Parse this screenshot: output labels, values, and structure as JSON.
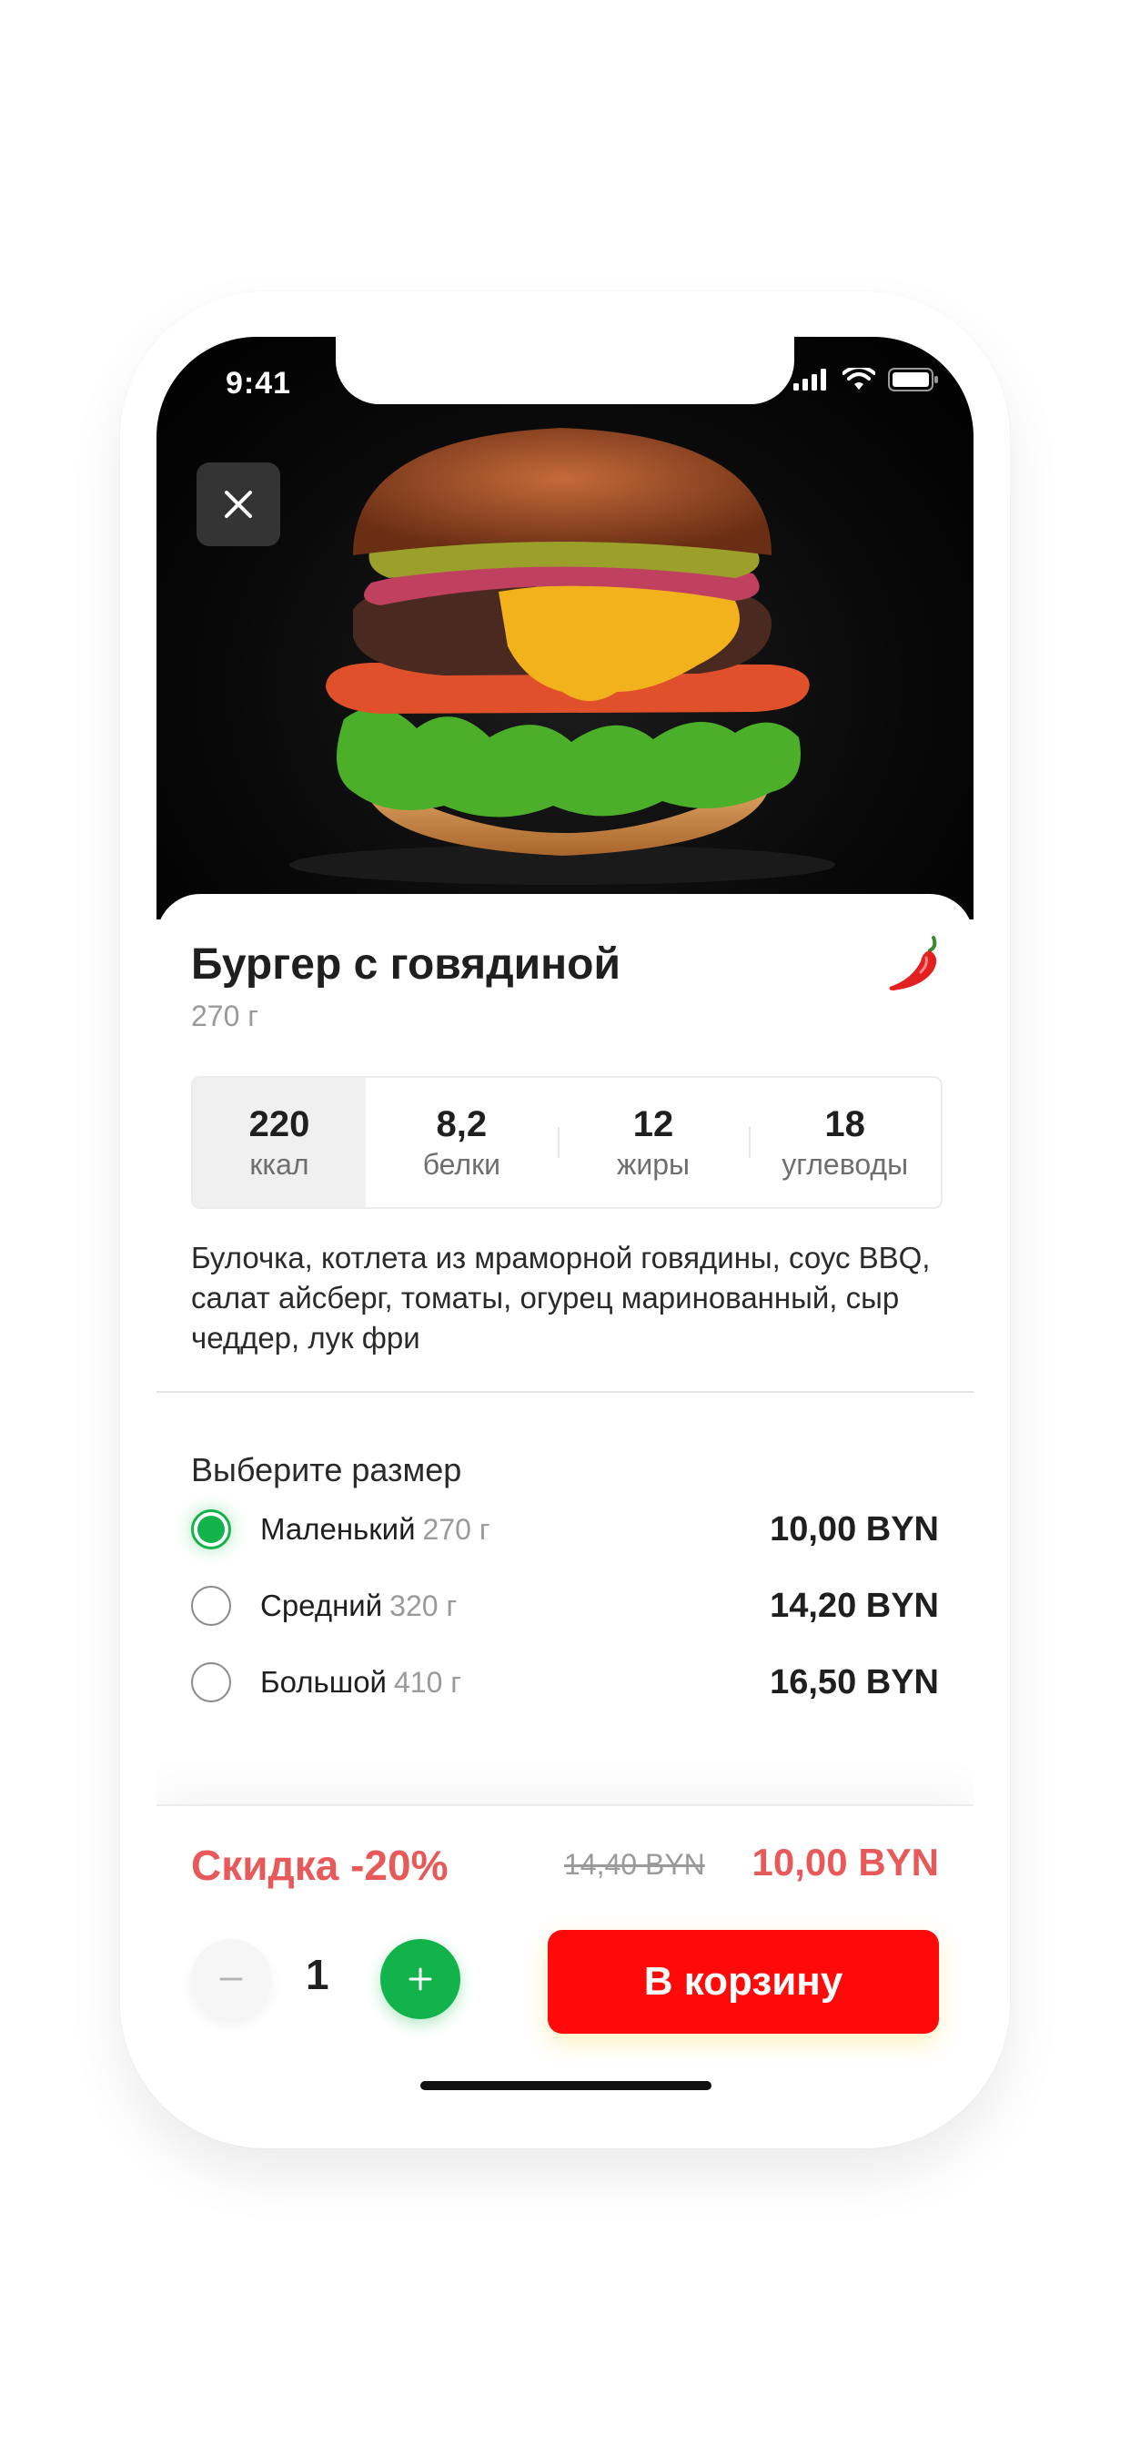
{
  "status_bar": {
    "time": "9:41"
  },
  "product": {
    "title": "Бургер с говядиной",
    "weight": "270 г",
    "nutrition": [
      {
        "value": "220",
        "label": "ккал"
      },
      {
        "value": "8,2",
        "label": "белки"
      },
      {
        "value": "12",
        "label": "жиры"
      },
      {
        "value": "18",
        "label": "углеводы"
      }
    ],
    "description": "Булочка, котлета из мраморной говядины, соус BBQ, салат айсберг, томаты, огурец маринованный, сыр чеддер, лук фри"
  },
  "size_selector": {
    "title": "Выберите размер",
    "options": [
      {
        "name": "Маленький",
        "weight": "270 г",
        "price": "10,00 BYN",
        "selected": true
      },
      {
        "name": "Средний",
        "weight": "320 г",
        "price": "14,20 BYN",
        "selected": false
      },
      {
        "name": "Большой",
        "weight": "410 г",
        "price": "16,50 BYN",
        "selected": false
      }
    ]
  },
  "order": {
    "discount_label": "Скидка -20%",
    "old_price": "14,40 BYN",
    "new_price": "10,00 BYN",
    "quantity": "1",
    "add_to_cart_label": "В корзину"
  },
  "colors": {
    "accent_red": "#ff0a0a",
    "discount_red": "#e85a5a",
    "green": "#12b34a"
  },
  "icons": [
    "close-icon",
    "chili-icon",
    "signal-icon",
    "wifi-icon",
    "battery-icon",
    "minus-icon",
    "plus-icon"
  ]
}
